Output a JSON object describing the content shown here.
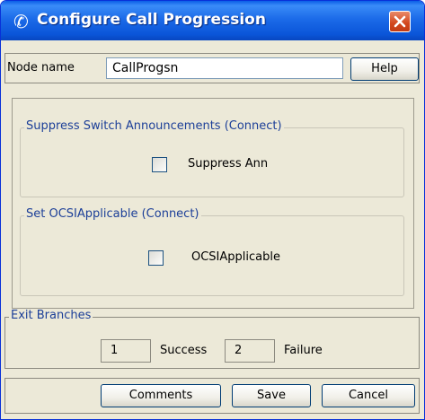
{
  "window": {
    "title": "Configure Call Progression",
    "title_icon": "phone-handset-icon",
    "close_icon": "close-icon"
  },
  "node": {
    "label": "Node name",
    "value": "CallProgsn",
    "help_label": "Help"
  },
  "suppress_group": {
    "title": "Suppress Switch Announcements (Connect)",
    "checkbox_label": "Suppress Ann",
    "checked": false
  },
  "ocsi_group": {
    "title": "Set OCSIApplicable (Connect)",
    "checkbox_label": "OCSIApplicable",
    "checked": false
  },
  "exit_branches": {
    "title": "Exit Branches",
    "branches": [
      {
        "number": "1",
        "label": "Success"
      },
      {
        "number": "2",
        "label": "Failure"
      }
    ]
  },
  "footer": {
    "comments_label": "Comments",
    "save_label": "Save",
    "cancel_label": "Cancel"
  },
  "colors": {
    "titlebar": "#0a55d8",
    "dialog_bg": "#ece9d8",
    "group_title": "#1c3f98",
    "close_button": "#d2461c"
  }
}
